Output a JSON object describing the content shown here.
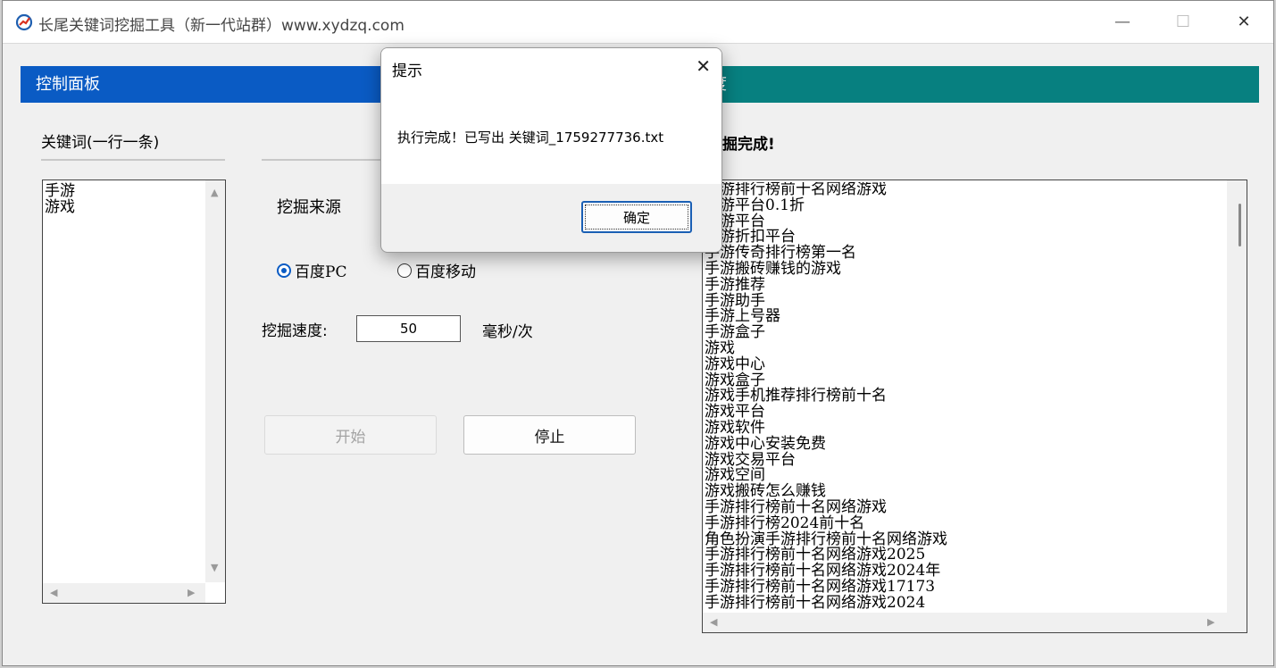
{
  "window": {
    "title": "长尾关键词挖掘工具（新一代站群）www.xydzq.com",
    "controls": {
      "minimize": "—",
      "maximize": "☐",
      "close": "✕"
    }
  },
  "left_panel": {
    "header": "控制面板",
    "keywords_label": "关键词(一行一条)",
    "keywords_text": "手游\n游戏",
    "source_label": "挖掘来源",
    "sources": [
      {
        "label": "百度PC",
        "selected": true
      },
      {
        "label": "百度移动",
        "selected": false
      }
    ],
    "speed_label": "挖掘速度:",
    "speed_value": "50",
    "speed_unit": "毫秒/次",
    "start_button": "开始",
    "stop_button": "停止"
  },
  "right_panel": {
    "header": "进度",
    "status": "掘完成!",
    "results": [
      "手游排行榜前十名网络游戏",
      "手游平台0.1折",
      "手游平台",
      "手游折扣平台",
      "手游传奇排行榜第一名",
      "手游搬砖赚钱的游戏",
      "手游推荐",
      "手游助手",
      "手游上号器",
      "手游盒子",
      "游戏",
      "游戏中心",
      "游戏盒子",
      "游戏手机推荐排行榜前十名",
      "游戏平台",
      "游戏软件",
      "游戏中心安装免费",
      "游戏交易平台",
      "游戏空间",
      "游戏搬砖怎么赚钱",
      "手游排行榜前十名网络游戏",
      "手游排行榜2024前十名",
      "角色扮演手游排行榜前十名网络游戏",
      "手游排行榜前十名网络游戏2025",
      "手游排行榜前十名网络游戏2024年",
      "手游排行榜前十名网络游戏17173",
      "手游排行榜前十名网络游戏2024"
    ]
  },
  "dialog": {
    "title": "提示",
    "message": "执行完成！已写出 关键词_1759277736.txt",
    "ok_button": "确定",
    "close": "✕"
  },
  "colors": {
    "left_header": "#0a5bc4",
    "right_header": "#078080"
  }
}
